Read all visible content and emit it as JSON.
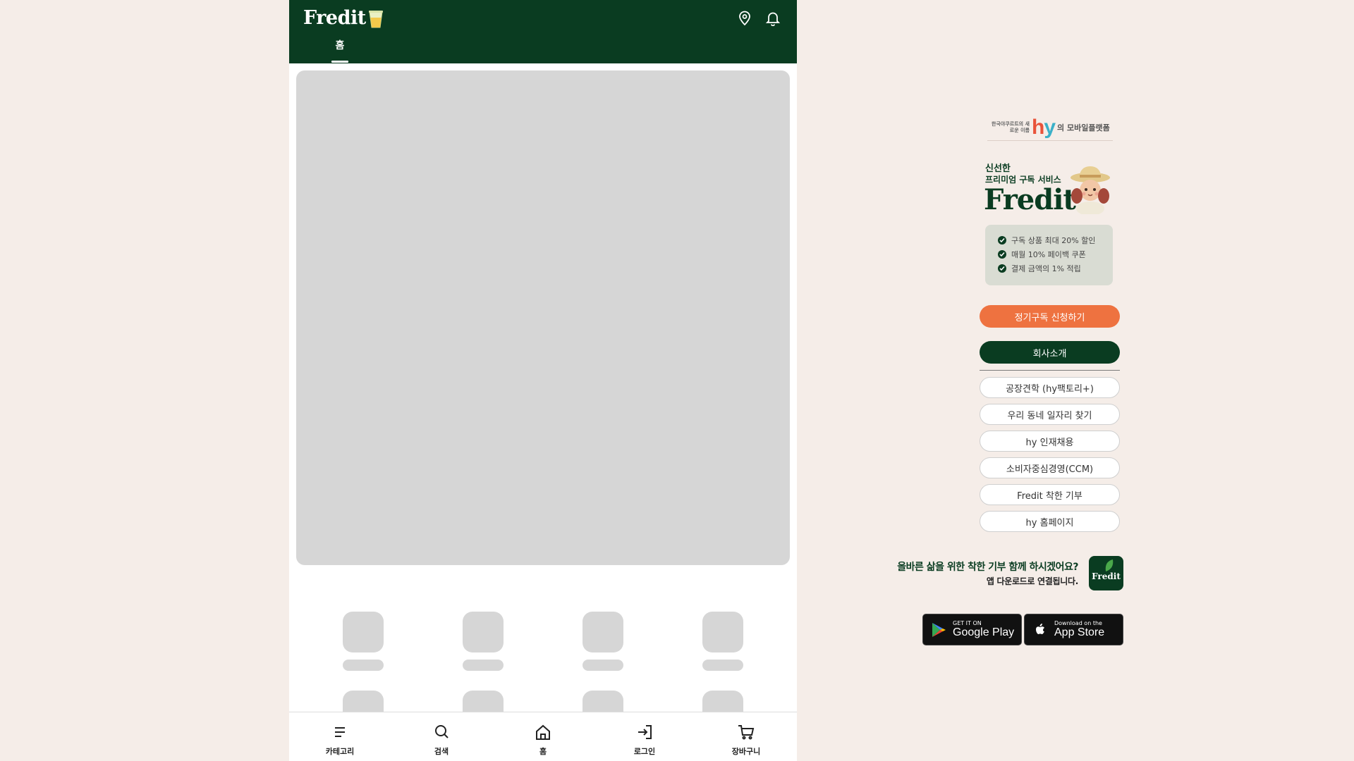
{
  "header": {
    "logo_text": "Fredit",
    "tabs": [
      {
        "label": "홈",
        "active": true
      }
    ]
  },
  "bottom_nav": [
    {
      "label": "카테고리",
      "icon": "menu-icon"
    },
    {
      "label": "검색",
      "icon": "search-icon"
    },
    {
      "label": "홈",
      "icon": "home-icon"
    },
    {
      "label": "로그인",
      "icon": "login-icon"
    },
    {
      "label": "장바구니",
      "icon": "cart-icon"
    }
  ],
  "promo": {
    "hy_small_text": "한국야쿠르트의 새로운 이름",
    "hy_logo": "hy",
    "hy_after": "의 모바일플랫폼",
    "fresh_line1": "신선한",
    "fresh_line2": "프리미엄 구독 서비스",
    "brand": "Fredit",
    "benefits": [
      "구독 상품 최대 20% 할인",
      "매월 10% 페이백 쿠폰",
      "결제 금액의 1% 적립"
    ],
    "subscribe_button": "정기구독 신청하기",
    "company_button": "회사소개",
    "links": [
      "공장견학 (hy팩토리+)",
      "우리 동네 일자리 찾기",
      "hy 인재채용",
      "소비자중심경영(CCM)",
      "Fredit 착한 기부",
      "hy 홈페이지"
    ],
    "donate_line1": "올바른 삶을 위한 착한 기부 함께 하시겠어요?",
    "donate_line2": "앱 다운로드로 연결됩니다.",
    "app_icon_text": "Fredit",
    "google_small": "GET IT ON",
    "google_big": "Google Play",
    "apple_small": "Download on the",
    "apple_big": "App Store"
  },
  "colors": {
    "brand_green": "#0a3c21",
    "accent_orange": "#ee7240",
    "page_background": "#f5ede8",
    "skeleton": "#d6d6d6"
  }
}
